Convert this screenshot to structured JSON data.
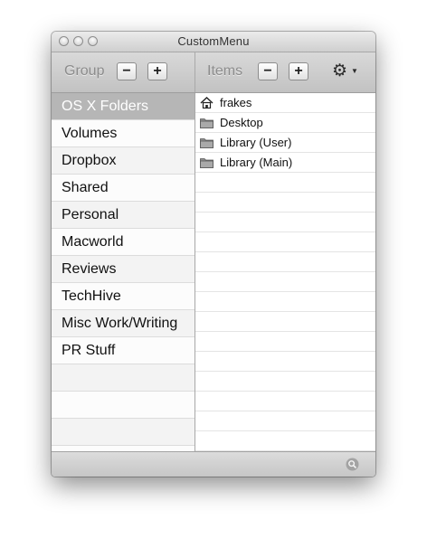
{
  "window": {
    "title": "CustomMenu"
  },
  "toolbar": {
    "group_label": "Group",
    "items_label": "Items",
    "remove_label": "−",
    "add_label": "+",
    "gear_icon": "gear-icon"
  },
  "groups": [
    {
      "label": "OS X Folders",
      "selected": true
    },
    {
      "label": "Volumes"
    },
    {
      "label": "Dropbox"
    },
    {
      "label": "Shared"
    },
    {
      "label": "Personal"
    },
    {
      "label": "Macworld"
    },
    {
      "label": "Reviews"
    },
    {
      "label": "TechHive"
    },
    {
      "label": "Misc Work/Writing"
    },
    {
      "label": "PR Stuff"
    }
  ],
  "items": [
    {
      "label": "frakes",
      "icon": "home-icon"
    },
    {
      "label": "Desktop",
      "icon": "folder-icon"
    },
    {
      "label": "Library (User)",
      "icon": "folder-icon"
    },
    {
      "label": "Library (Main)",
      "icon": "folder-icon"
    }
  ],
  "statusbar": {
    "search_icon": "search-icon"
  },
  "colors": {
    "selected_row": "#b6b6b6",
    "toolbar_label": "#8c8c8c",
    "alt_row": "#f3f3f3"
  }
}
